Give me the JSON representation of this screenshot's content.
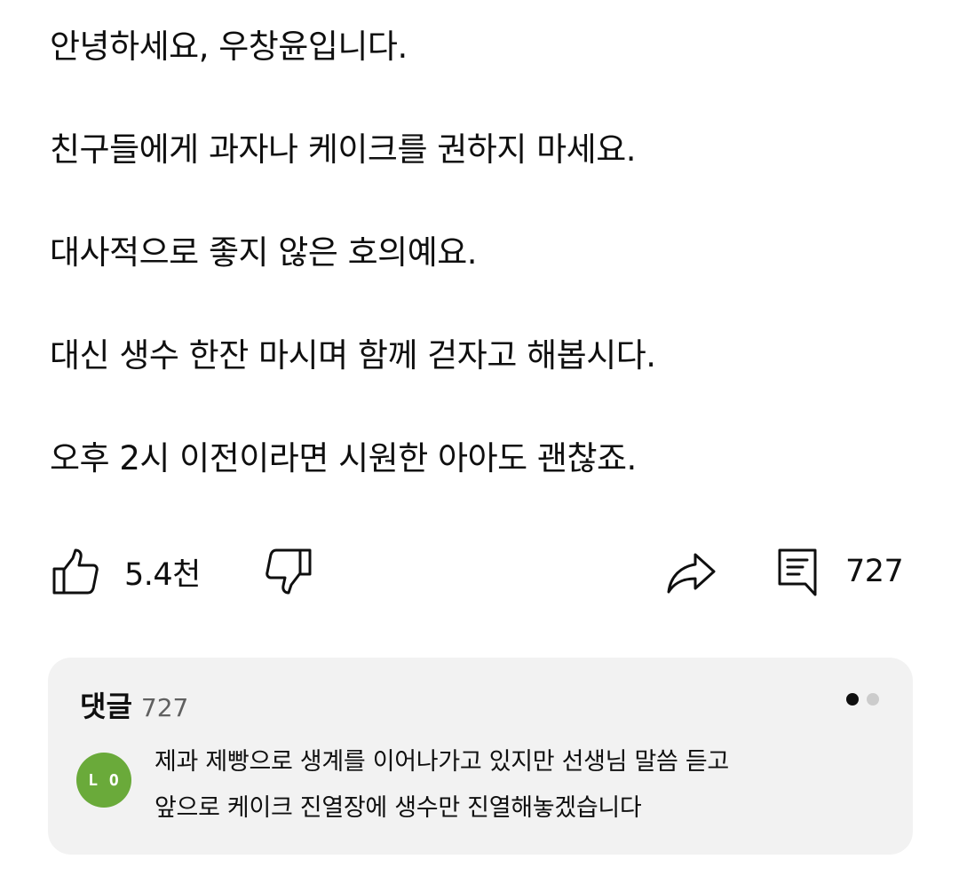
{
  "post": {
    "lines": [
      "안녕하세요, 우창윤입니다.",
      "친구들에게 과자나 케이크를 권하지 마세요.",
      "대사적으로 좋지 않은 호의예요.",
      "대신 생수 한잔 마시며 함께 걷자고 해봅시다.",
      "오후 2시 이전이라면 시원한 아아도 괜찮죠."
    ]
  },
  "actions": {
    "like_icon": "thumbs-up-icon",
    "like_count": "5.4천",
    "dislike_icon": "thumbs-down-icon",
    "share_icon": "share-arrow-icon",
    "comment_icon": "comment-icon",
    "comment_count": "727"
  },
  "comments": {
    "title": "댓글",
    "count": "727",
    "pager": {
      "active_color": "#0f0f0f",
      "inactive_color": "#cccccc"
    },
    "top_comment": {
      "avatar_text": "L O",
      "avatar_color": "#6aaa3a",
      "lines": [
        "제과 제빵으로 생계를 이어나가고 있지만 선생님 말씀 듣고",
        "앞으로 케이크 진열장에 생수만 진열해놓겠습니다"
      ]
    }
  }
}
